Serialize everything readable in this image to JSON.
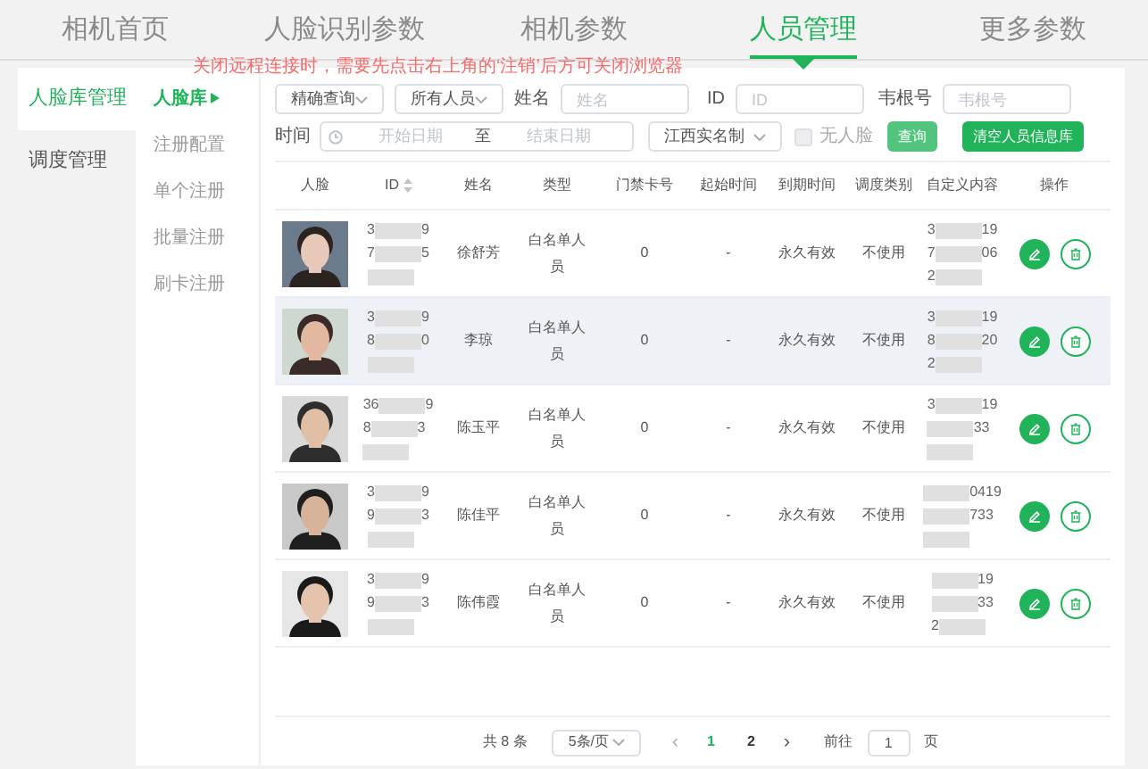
{
  "top_tabs": [
    {
      "label": "相机首页",
      "selected": false
    },
    {
      "label": "人脸识别参数",
      "selected": false
    },
    {
      "label": "相机参数",
      "selected": false
    },
    {
      "label": "人员管理",
      "selected": true
    },
    {
      "label": "更多参数",
      "selected": false
    }
  ],
  "notice": "关闭远程连接时，需要先点击右上角的‘注销’后方可关闭浏览器",
  "sidebar": {
    "items": [
      {
        "label": "人脸库管理",
        "selected": true
      },
      {
        "label": "调度管理",
        "selected": false
      }
    ]
  },
  "subnav": {
    "items": [
      {
        "label": "人脸库",
        "selected": true
      },
      {
        "label": "注册配置",
        "selected": false
      },
      {
        "label": "单个注册",
        "selected": false
      },
      {
        "label": "批量注册",
        "selected": false
      },
      {
        "label": "刷卡注册",
        "selected": false
      }
    ]
  },
  "filters": {
    "query_mode": "精确查询",
    "people": "所有人员",
    "name_label": "姓名",
    "name_placeholder": "姓名",
    "id_label": "ID",
    "id_placeholder": "ID",
    "wiegand_label": "韦根号",
    "wiegand_placeholder": "韦根号",
    "time_label": "时间",
    "start_placeholder": "开始日期",
    "range_separator": "至",
    "end_placeholder": "结束日期",
    "region": "江西实名制",
    "no_face": {
      "label": "无人脸",
      "checked": false
    },
    "search_button": "查询",
    "clear_button": "清空人员信息库"
  },
  "table": {
    "columns": [
      "人脸",
      "ID",
      "姓名",
      "类型",
      "门禁卡号",
      "起始时间",
      "到期时间",
      "调度类别",
      "自定义内容",
      "操作"
    ],
    "rows": [
      {
        "face": {
          "kind": "picture"
        },
        "id": [
          {
            "head": "3",
            "tail": "9"
          },
          {
            "head": "7",
            "tail": "5"
          }
        ],
        "name": "徐舒芳",
        "type": "白名单人员",
        "card": "0",
        "start": "-",
        "end": "永久有效",
        "schedule": "不使用",
        "custom": [
          {
            "head": "3",
            "tail": "19"
          },
          {
            "head": "7",
            "tail": "06"
          },
          {
            "head": "2"
          }
        ],
        "selected": false
      },
      {
        "face": {
          "kind": "picture"
        },
        "id": [
          {
            "head": "3",
            "tail": "9"
          },
          {
            "head": "8",
            "tail": "0"
          }
        ],
        "name": "李琼",
        "type": "白名单人员",
        "card": "0",
        "start": "-",
        "end": "永久有效",
        "schedule": "不使用",
        "custom": [
          {
            "head": "3",
            "tail": "19"
          },
          {
            "head": "8",
            "tail": "20"
          },
          {
            "head": "2"
          }
        ],
        "selected": true
      },
      {
        "face": {
          "kind": "picture"
        },
        "id": [
          {
            "head": "36",
            "tail": "9"
          },
          {
            "head": "8",
            "tail": "3"
          }
        ],
        "name": "陈玉平",
        "type": "白名单人员",
        "card": "0",
        "start": "-",
        "end": "永久有效",
        "schedule": "不使用",
        "custom": [
          {
            "head": "3",
            "tail": "19"
          },
          {
            "tail": "33"
          }
        ],
        "selected": false
      },
      {
        "face": {
          "kind": "picture"
        },
        "id": [
          {
            "head": "3",
            "tail": "9"
          },
          {
            "head": "9",
            "tail": "3"
          }
        ],
        "name": "陈佳平",
        "type": "白名单人员",
        "card": "0",
        "start": "-",
        "end": "永久有效",
        "schedule": "不使用",
        "custom": [
          {
            "tail": "0419"
          },
          {
            "tail": "733"
          }
        ],
        "selected": false
      },
      {
        "face": {
          "kind": "picture"
        },
        "id": [
          {
            "head": "3",
            "tail": "9"
          },
          {
            "head": "9",
            "tail": "3"
          }
        ],
        "name": "陈伟霞",
        "type": "白名单人员",
        "card": "0",
        "start": "-",
        "end": "永久有效",
        "schedule": "不使用",
        "custom": [
          {
            "tail": "19"
          },
          {
            "tail": "33"
          },
          {
            "head": "2"
          }
        ],
        "selected": false
      }
    ]
  },
  "pagination": {
    "total": "共 8 条",
    "page_size": "5条/页",
    "prev": "‹",
    "pages": [
      {
        "label": "1",
        "selected": true
      },
      {
        "label": "2",
        "selected": false
      }
    ],
    "next": "›",
    "goto_label": "前往",
    "goto_value": "1",
    "goto_suffix": "页"
  }
}
